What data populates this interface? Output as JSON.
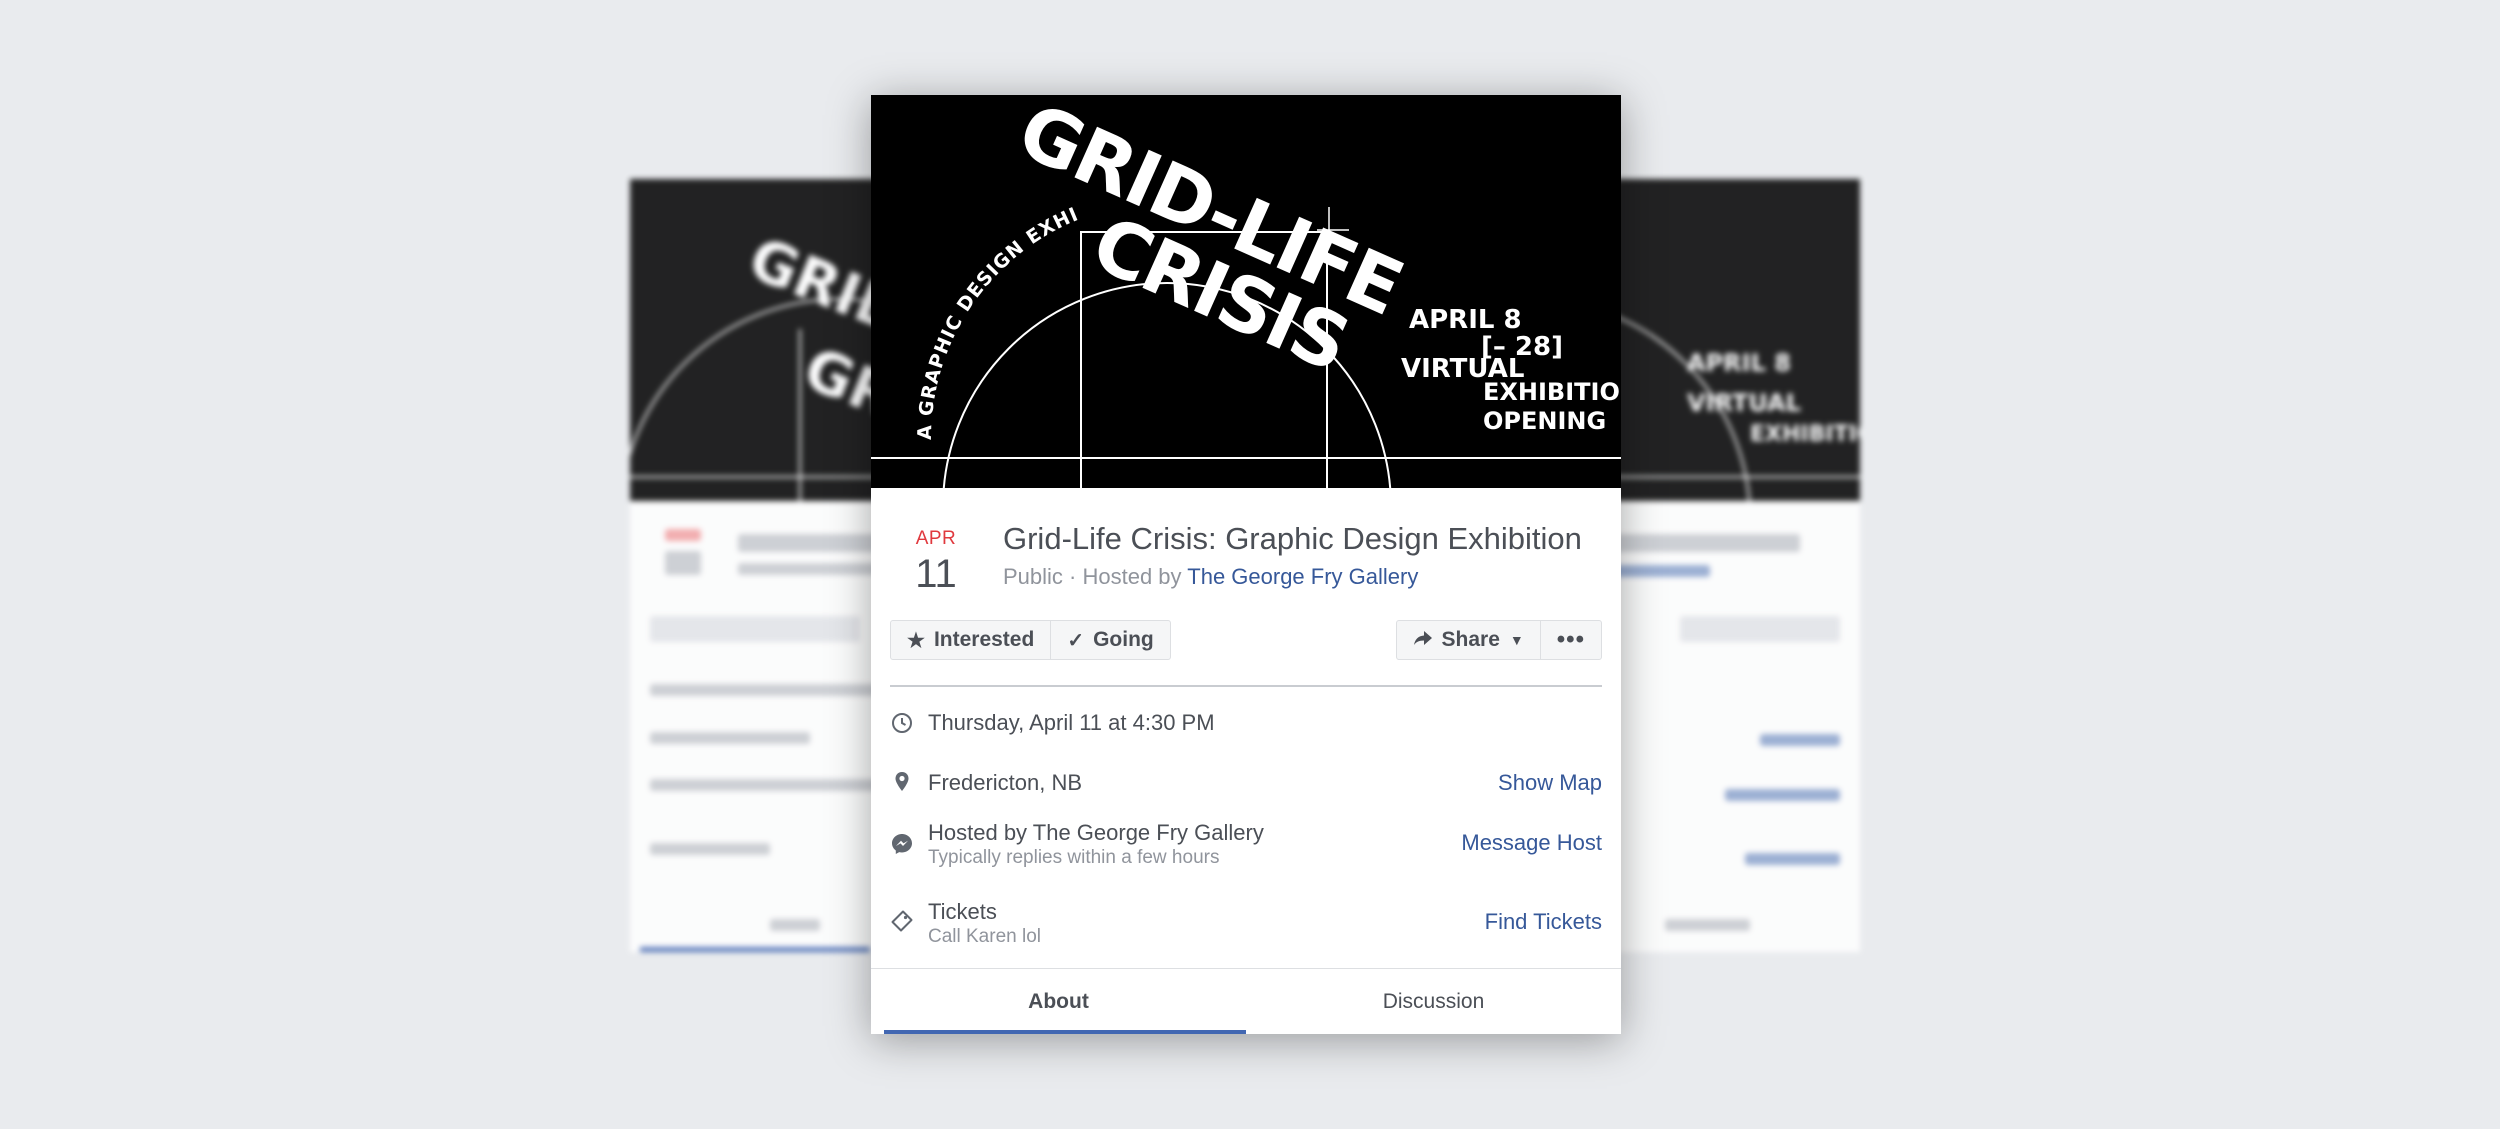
{
  "poster": {
    "title_line1": "GRID-LIFE",
    "title_line2": "CRISIS",
    "arc_text": "A GRAPHIC DESIGN EXHIBITION",
    "dates_a": "APRIL 8",
    "dates_b": "[– 28]",
    "virtual": "VIRTUAL",
    "exhibition": "EXHIBITION",
    "opening": "OPENING"
  },
  "event": {
    "month": "APR",
    "day": "11",
    "title": "Grid-Life Crisis: Graphic Design Exhibition",
    "privacy": "Public",
    "hosted_prefix": "· Hosted by",
    "host_name": "The George Fry Gallery"
  },
  "actions": {
    "interested": "Interested",
    "going": "Going",
    "share": "Share",
    "more": "•••"
  },
  "details": {
    "datetime": "Thursday, April 11 at 4:30 PM",
    "location": "Fredericton, NB",
    "show_map": "Show Map",
    "hosted_by": "Hosted by The George Fry Gallery",
    "reply_time": "Typically replies within a few hours",
    "message_host": "Message Host",
    "tickets": "Tickets",
    "tickets_note": "Call Karen lol",
    "find_tickets": "Find Tickets"
  },
  "tabs": {
    "about": "About",
    "discussion": "Discussion"
  },
  "colors": {
    "background": "#e9ebee",
    "accent_blue": "#4267b2",
    "link_blue": "#365899",
    "month_red": "#e0393e"
  },
  "icons": [
    "star-icon",
    "check-icon",
    "share-arrow-icon",
    "caret-down-icon",
    "clock-icon",
    "location-pin-icon",
    "messenger-icon",
    "ticket-icon"
  ]
}
